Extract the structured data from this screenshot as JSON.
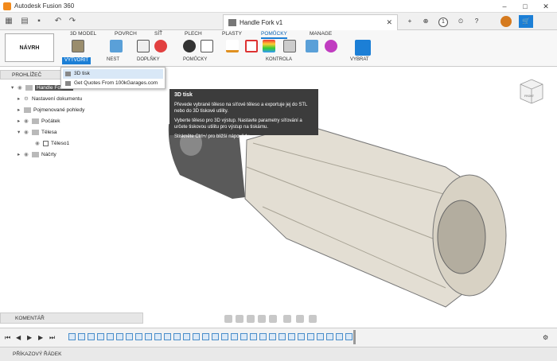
{
  "app": {
    "title": "Autodesk Fusion 360"
  },
  "document": {
    "tab_title": "Handle Fork v1"
  },
  "header_right": {
    "notifications_count": "1"
  },
  "ribbon": {
    "workspace_label": "NÁVRH",
    "tabs": [
      "3D MODEL",
      "POVRCH",
      "SÍŤ",
      "PLECH",
      "PLASTY",
      "POMŮCKY",
      "MANAGE"
    ],
    "active_tab": "POMŮCKY",
    "groups": {
      "vytvorit": "VYTVOŘIT",
      "nest": "NEST",
      "doplnky": "DOPLŇKY",
      "pomucky": "POMŮCKY",
      "kontrola": "KONTROLA",
      "vybrat": "VYBRAT"
    }
  },
  "browser": {
    "header": "PROHLÍŽEČ",
    "root": "Handle Fork v1",
    "items": [
      "Nastavení dokumentu",
      "Pojmenované pohledy",
      "Počátek",
      "Tělesa",
      "Těleso1",
      "Náčrty"
    ]
  },
  "dropdown": {
    "items": [
      "3D tisk",
      "Get Quotes From 100kGarages.com"
    ]
  },
  "tooltip": {
    "title": "3D tisk",
    "p1": "Převede vybrané těleso na síťové těleso a exportuje jej do STL nebo do 3D tiskové utility.",
    "p2": "Vyberte těleso pro 3D výstup. Nastavte parametry síťování a určete tiskovou utilitu pro výstup na tiskárnu.",
    "p3": "Stiskněte Ctrl+/ pro bližší nápovědu."
  },
  "comments": {
    "label": "KOMENTÁŘ"
  },
  "command_line": {
    "label": "PŘÍKAZOVÝ ŘÁDEK"
  },
  "viewcube": {
    "face": "FRONT"
  },
  "colors": {
    "accent": "#1c7fd6",
    "tooltip_bg": "#3c3c3c",
    "model_body": "#e3ded3",
    "model_dark": "#555555"
  }
}
